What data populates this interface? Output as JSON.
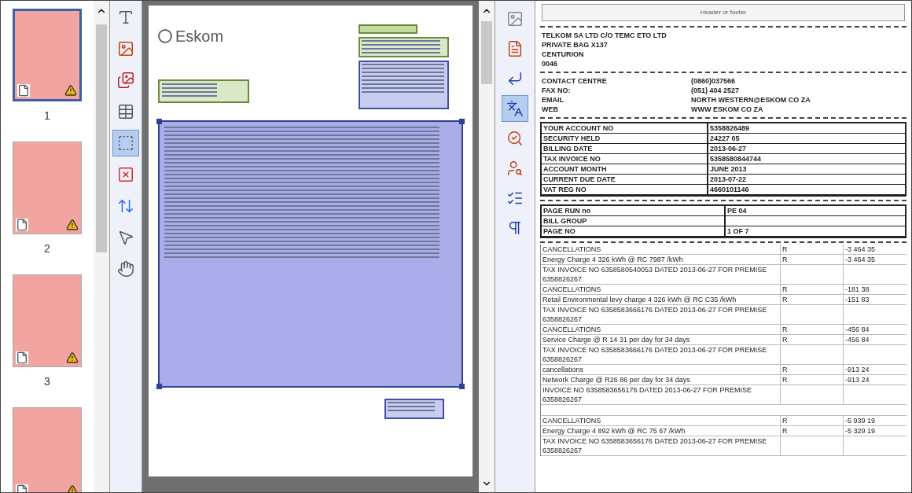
{
  "thumbnails": [
    {
      "label": "1",
      "selected": true
    },
    {
      "label": "2",
      "selected": false
    },
    {
      "label": "3",
      "selected": false
    },
    {
      "selected": false
    }
  ],
  "image_tools": [
    {
      "kind": "text-area",
      "selected": false
    },
    {
      "kind": "picture-area",
      "selected": false
    },
    {
      "kind": "background-picture-area",
      "selected": false
    },
    {
      "kind": "table-area",
      "selected": false
    },
    {
      "kind": "recognition-area",
      "selected": true
    },
    {
      "kind": "delete-area",
      "selected": false
    },
    {
      "kind": "order-areas",
      "selected": false
    },
    {
      "kind": "pointer",
      "selected": false
    },
    {
      "kind": "hand",
      "selected": false
    }
  ],
  "page_image": {
    "logo_text": "Eskom"
  },
  "text_tools": [
    {
      "kind": "picture",
      "selected": false
    },
    {
      "kind": "page-view",
      "selected": false
    },
    {
      "kind": "line-break",
      "selected": false
    },
    {
      "kind": "ligature",
      "selected": true
    },
    {
      "kind": "verify",
      "selected": false
    },
    {
      "kind": "find",
      "selected": false
    },
    {
      "kind": "check",
      "selected": false
    },
    {
      "kind": "pilcrow",
      "selected": false
    }
  ],
  "text_editor": {
    "header_label": "Header or footer",
    "address": [
      "TELKOM SA LTD C/O TEMC ETO LTD",
      "PRIVATE BAG X137",
      "CENTURION",
      "0046"
    ],
    "contacts": [
      {
        "label": "CONTACT CENTRE",
        "value": "(0860)037566"
      },
      {
        "label": "FAX NO:",
        "value": "(051) 404 2527"
      },
      {
        "label": "EMAIL",
        "value": "NORTH WESTERN@ESKOM CO ZA"
      },
      {
        "label": "WEB",
        "value": "WWW ESKOM CO ZA"
      }
    ],
    "account_table": [
      [
        "YOUR ACCOUNT NO",
        "5358826489"
      ],
      [
        "SECURITY HELD",
        "24227 05"
      ],
      [
        "BILLING DATE",
        "2013-06-27"
      ],
      [
        "TAX INVOICE NO",
        "5358580844744"
      ],
      [
        "ACCOUNT MONTH",
        "JUNE 2013"
      ],
      [
        "CURRENT DUE DATE",
        "2013-07-22"
      ],
      [
        "VAT REG NO",
        "4660101146"
      ]
    ],
    "page_table": [
      [
        "PAGE RUN no",
        "PE 04"
      ],
      [
        "BILL GROUP"
      ],
      [
        "PAGE NO",
        "1 OF 7"
      ]
    ],
    "charges": [
      {
        "description": "CANCELLATIONS",
        "currency": "R",
        "amount": "-3 464 35"
      },
      {
        "description": "Energy Charge 4 326 kWh @ RC 7987 /kWh",
        "currency": "R",
        "amount": "-3 464 35"
      },
      {
        "description": "TAX INVOICE NO 6358580540053 DATED 2013-06-27 FOR PREMISE 6358826267"
      },
      {
        "description": "CANCELLATIONS",
        "currency": "R",
        "amount": "-181 38"
      },
      {
        "description": "Retail Environmental levy charge 4 326 kWh @ RC C35 /kWh",
        "currency": "R",
        "amount": "-151 83"
      },
      {
        "description": "TAX INVOICE NO 6358583666176 DATED 2013-06-27 FOR PREMISE 6358826267"
      },
      {
        "description": "CANCELLATIONS",
        "currency": "R",
        "amount": "-456 84"
      },
      {
        "description": "Service Charge @ R 14 31 per day for 34 days",
        "currency": "R",
        "amount": "-456 84"
      },
      {
        "description": "TAX INVOICE NO 6358583666176 DATED 2013-06-27 FOR PREMISE 6358826267"
      },
      {
        "description": "cancellations",
        "currency": "R",
        "amount": "-913 24"
      },
      {
        "description": "Network Charge @ R26 86 per day for 34 days",
        "currency": "R",
        "amount": "-913 24"
      },
      {
        "description": "INVOICE NO 6358583656176 DATED 2013-06-27 FOR PREMISE 6358826267"
      },
      {
        "kind": "blank"
      },
      {
        "description": "CANCELLATIONS",
        "currency": "R",
        "amount": "-5 939 19"
      },
      {
        "description": "Energy Charge 4 892 kWh @ RC 75 67 /kWh",
        "currency": "R",
        "amount": "-5 329 19"
      },
      {
        "description": "TAX INVOICE NO 6358583656176 DATED 2013-06-27 FOR PREMISE 6358826267"
      }
    ]
  }
}
